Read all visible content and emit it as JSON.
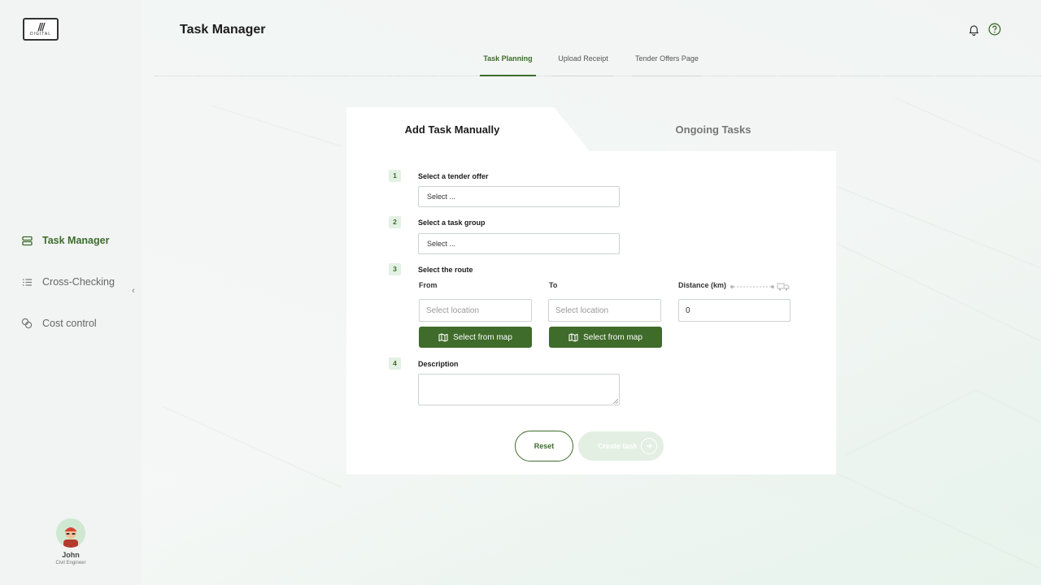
{
  "app": {
    "logo_text": "DIGITAL",
    "page_title": "Task Manager"
  },
  "header": {
    "icons": [
      "bell-icon",
      "help-icon"
    ]
  },
  "sidebar": {
    "items": [
      {
        "label": "Task Manager",
        "icon": "list-icon",
        "active": true
      },
      {
        "label": "Cross-Checking",
        "icon": "checklist-icon",
        "active": false
      },
      {
        "label": "Cost control",
        "icon": "coins-icon",
        "active": false
      }
    ],
    "collapse_glyph": "‹",
    "user": {
      "name": "John",
      "role": "Civil Engineer"
    }
  },
  "top_tabs": [
    {
      "label": "Task Planning",
      "active": true
    },
    {
      "label": "Upload Receipt",
      "active": false
    },
    {
      "label": "Tender Offers Page",
      "active": false
    }
  ],
  "card_tabs": {
    "left": "Add Task Manually",
    "right": "Ongoing Tasks"
  },
  "form": {
    "step1": {
      "num": "1",
      "label": "Select a tender offer",
      "value": "Select ..."
    },
    "step2": {
      "num": "2",
      "label": "Select a task group",
      "value": "Select ..."
    },
    "step3": {
      "num": "3",
      "label": "Select the route",
      "from_label": "From",
      "to_label": "To",
      "distance_label": "Distance (km)",
      "from_placeholder": "Select location",
      "to_placeholder": "Select location",
      "distance_value": "0",
      "map_button": "Select from map"
    },
    "step4": {
      "num": "4",
      "label": "Description"
    },
    "reset": "Reset",
    "create": "Create task"
  },
  "colors": {
    "accent": "#3f6b2b",
    "accent_light": "#e2f1e3",
    "sidebar_bg": "#f1f4f2"
  }
}
